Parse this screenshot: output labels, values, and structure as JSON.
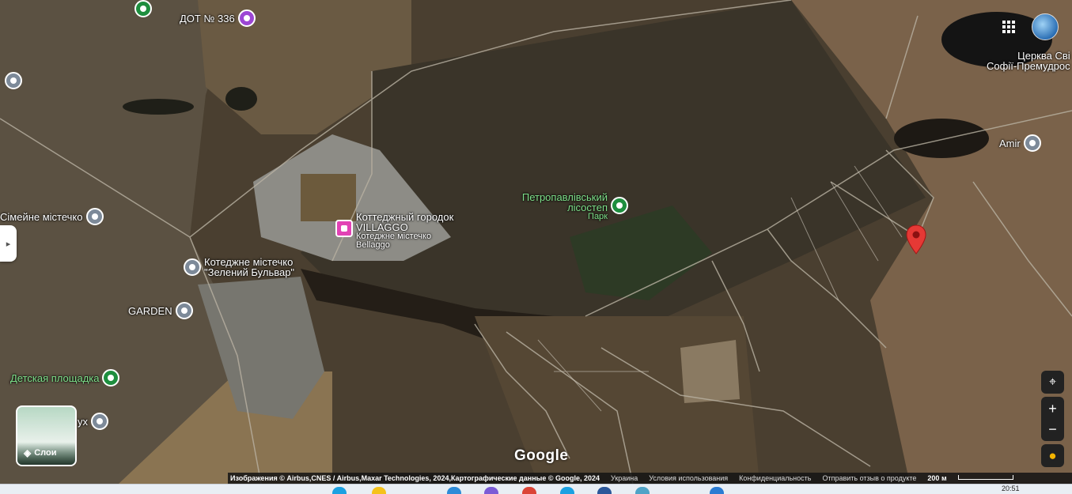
{
  "map": {
    "places": [
      {
        "id": "dot336",
        "label": "ДОТ № 336"
      },
      {
        "id": "villaggo",
        "label": "Коттеджный городок VILLAGGO",
        "sub": "Котеджне містечко Bellaggo"
      },
      {
        "id": "simeyne",
        "label": "Сімейне містечко"
      },
      {
        "id": "zeleniy",
        "label": "Котеджне містечко \"Зелений Бульвар\""
      },
      {
        "id": "garden",
        "label": "GARDEN"
      },
      {
        "id": "ploshchadka",
        "label": "Детская площадка"
      },
      {
        "id": "ukh",
        "label": "ух"
      },
      {
        "id": "park",
        "label": "Петропавлівський лісостеп",
        "sub": "Парк"
      },
      {
        "id": "amir",
        "label": "Amir"
      },
      {
        "id": "tserkva",
        "label": "Церква Сві",
        "sub": "Софії-Премудрос"
      }
    ],
    "layers_label": "Слои",
    "google_logo": "Google",
    "zoom_in": "+",
    "zoom_out": "−",
    "attribution": {
      "imagery": "Изображения © Airbus,CNES / Airbus,Maxar Technologies, 2024,Картографические данные © Google, 2024",
      "country": "Украина",
      "terms": "Условия использования",
      "privacy": "Конфиденциальность",
      "feedback": "Отправить отзыв о продукте",
      "scale": "200 м"
    }
  },
  "taskbar": {
    "time": "20:51"
  },
  "colors": {
    "marker": "#e53935",
    "park_pin": "#1e8e3e",
    "poi_pin": "#7d8a99",
    "lodging_pin": "#e242b5",
    "history_pin": "#9c46d4"
  }
}
